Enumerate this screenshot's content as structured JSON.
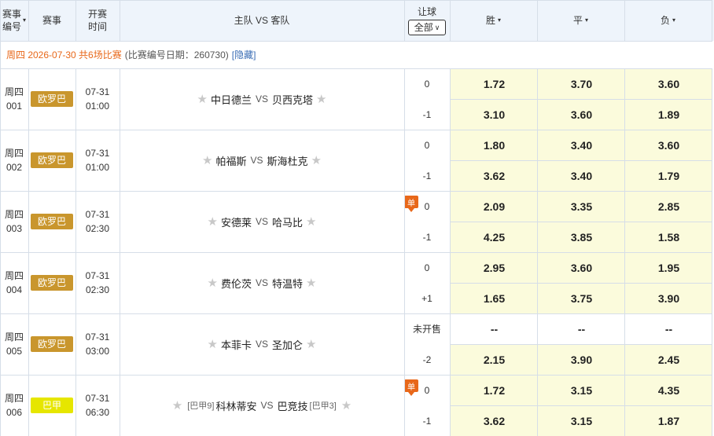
{
  "header": {
    "no_label_1": "赛事",
    "no_label_2": "编号",
    "no_arrow": "▾",
    "league_label": "赛事",
    "time_label_1": "开赛",
    "time_label_2": "时间",
    "teams_label": "主队 VS 客队",
    "handicap_label": "让球",
    "handicap_select_value": "全部",
    "win_label": "胜",
    "draw_label": "平",
    "lose_label": "负",
    "sort_arrow": "▾"
  },
  "date_row": {
    "main": "周四 2026-07-30 共6场比赛",
    "note": "(比赛编号日期：260730)",
    "hide_link": "[隐藏]"
  },
  "vs_text": "VS",
  "star": "★",
  "single_label": "单",
  "colors": {
    "europa_badge": "#c9962d",
    "brasil_badge": "#e6e600",
    "odds_bg": "#fbfbdc",
    "header_bg": "#eef4fb",
    "accent_orange": "#e8681a"
  },
  "matches": [
    {
      "day": "周四",
      "num": "001",
      "league": "欧罗巴",
      "league_color": "#c9962d",
      "date": "07-31",
      "time": "01:00",
      "home": "中日德兰",
      "away": "贝西克塔",
      "home_rank": "",
      "away_rank": "",
      "single": false,
      "not_on_sale": false,
      "rows": [
        {
          "hcp": "0",
          "win": "1.72",
          "draw": "3.70",
          "lose": "3.60"
        },
        {
          "hcp": "-1",
          "win": "3.10",
          "draw": "3.60",
          "lose": "1.89"
        }
      ]
    },
    {
      "day": "周四",
      "num": "002",
      "league": "欧罗巴",
      "league_color": "#c9962d",
      "date": "07-31",
      "time": "01:00",
      "home": "帕福斯",
      "away": "斯海杜克",
      "home_rank": "",
      "away_rank": "",
      "single": false,
      "not_on_sale": false,
      "rows": [
        {
          "hcp": "0",
          "win": "1.80",
          "draw": "3.40",
          "lose": "3.60"
        },
        {
          "hcp": "-1",
          "win": "3.62",
          "draw": "3.40",
          "lose": "1.79"
        }
      ]
    },
    {
      "day": "周四",
      "num": "003",
      "league": "欧罗巴",
      "league_color": "#c9962d",
      "date": "07-31",
      "time": "02:30",
      "home": "安德莱",
      "away": "哈马比",
      "home_rank": "",
      "away_rank": "",
      "single": true,
      "not_on_sale": false,
      "rows": [
        {
          "hcp": "0",
          "win": "2.09",
          "draw": "3.35",
          "lose": "2.85"
        },
        {
          "hcp": "-1",
          "win": "4.25",
          "draw": "3.85",
          "lose": "1.58"
        }
      ]
    },
    {
      "day": "周四",
      "num": "004",
      "league": "欧罗巴",
      "league_color": "#c9962d",
      "date": "07-31",
      "time": "02:30",
      "home": "费伦茨",
      "away": "特温特",
      "home_rank": "",
      "away_rank": "",
      "single": false,
      "not_on_sale": false,
      "rows": [
        {
          "hcp": "0",
          "win": "2.95",
          "draw": "3.60",
          "lose": "1.95"
        },
        {
          "hcp": "+1",
          "win": "1.65",
          "draw": "3.75",
          "lose": "3.90"
        }
      ]
    },
    {
      "day": "周四",
      "num": "005",
      "league": "欧罗巴",
      "league_color": "#c9962d",
      "date": "07-31",
      "time": "03:00",
      "home": "本菲卡",
      "away": "圣加仑",
      "home_rank": "",
      "away_rank": "",
      "single": false,
      "not_on_sale": true,
      "rows": [
        {
          "hcp": "未开售",
          "win": "--",
          "draw": "--",
          "lose": "--"
        },
        {
          "hcp": "-2",
          "win": "2.15",
          "draw": "3.90",
          "lose": "2.45"
        }
      ]
    },
    {
      "day": "周四",
      "num": "006",
      "league": "巴甲",
      "league_color": "#e6e600",
      "date": "07-31",
      "time": "06:30",
      "home": "科林蒂安",
      "away": "巴竞技",
      "home_rank": "[巴甲9]",
      "away_rank": "[巴甲3]",
      "single": true,
      "not_on_sale": false,
      "rows": [
        {
          "hcp": "0",
          "win": "1.72",
          "draw": "3.15",
          "lose": "4.35"
        },
        {
          "hcp": "-1",
          "win": "3.62",
          "draw": "3.15",
          "lose": "1.87"
        }
      ]
    }
  ]
}
